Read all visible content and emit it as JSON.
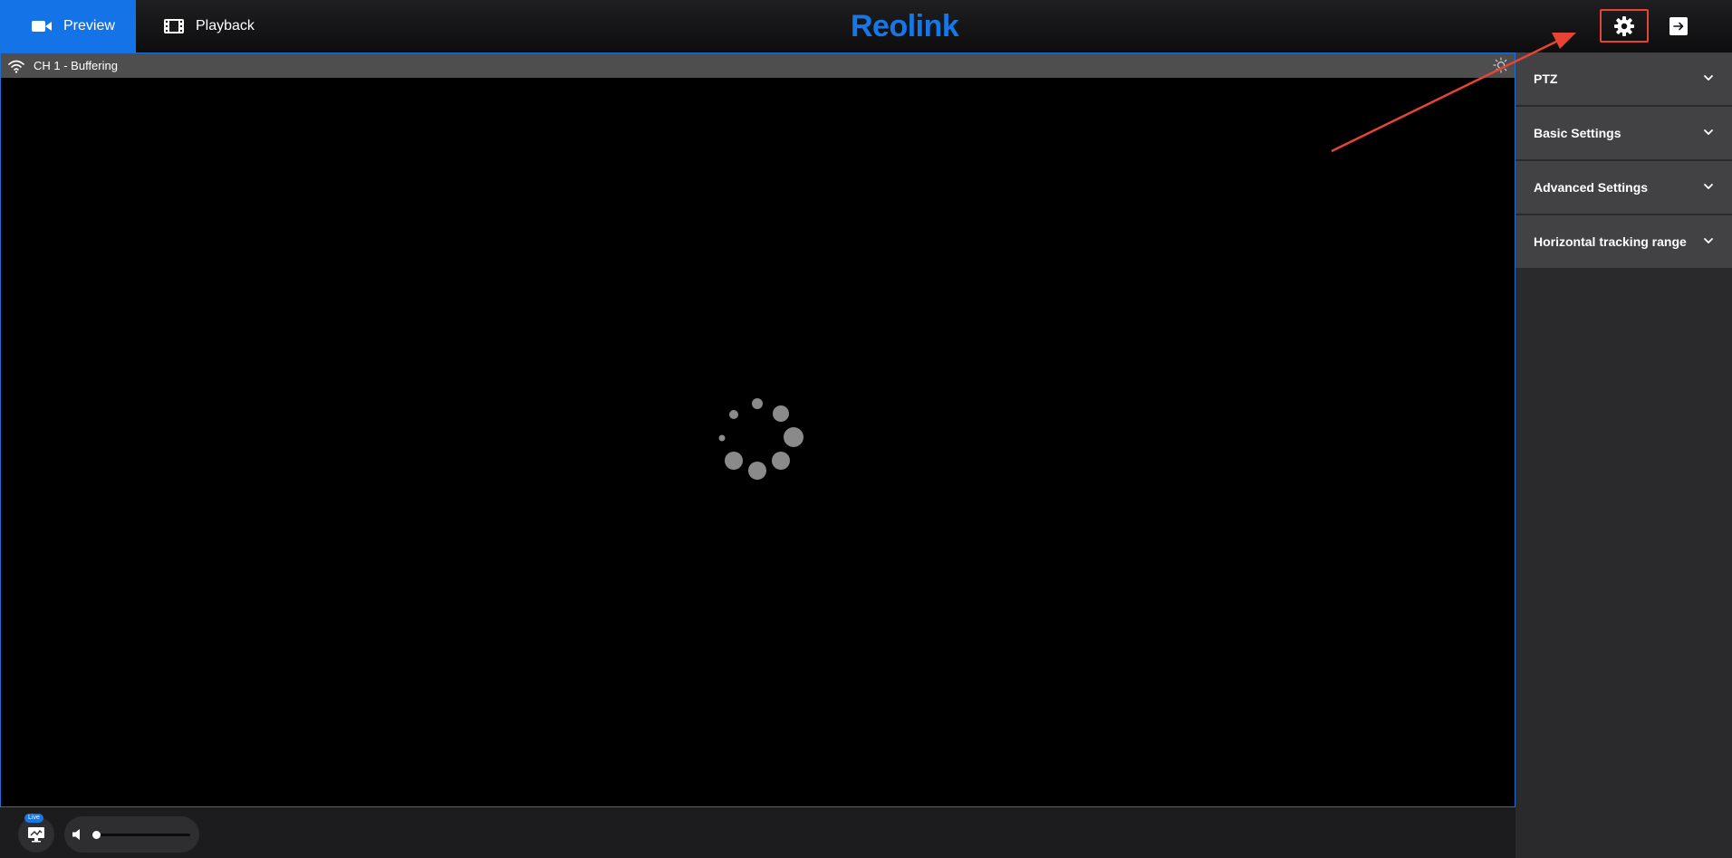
{
  "header": {
    "tabs": [
      {
        "label": "Preview",
        "icon": "video-camera-icon",
        "active": true
      },
      {
        "label": "Playback",
        "icon": "film-icon",
        "active": false
      }
    ],
    "logo_text": "Reolink",
    "settings_icon": "gear-icon",
    "logout_icon": "logout-icon",
    "accent_color": "#1473e6"
  },
  "video": {
    "channel_status": "CH 1 - Buffering",
    "signal_icon": "wifi-icon",
    "brightness_icon": "sun-icon",
    "loading_icon": "loading-spinner-icon"
  },
  "bottom_bar": {
    "live_badge": "Live",
    "live_icon": "monitor-icon",
    "volume_icon": "speaker-icon",
    "volume_level": 0.0
  },
  "side_panel": {
    "items": [
      {
        "label": "PTZ"
      },
      {
        "label": "Basic Settings"
      },
      {
        "label": "Advanced Settings"
      },
      {
        "label": "Horizontal tracking range"
      }
    ]
  },
  "annotation": {
    "highlight_color": "#e64434",
    "target": "settings-button"
  }
}
